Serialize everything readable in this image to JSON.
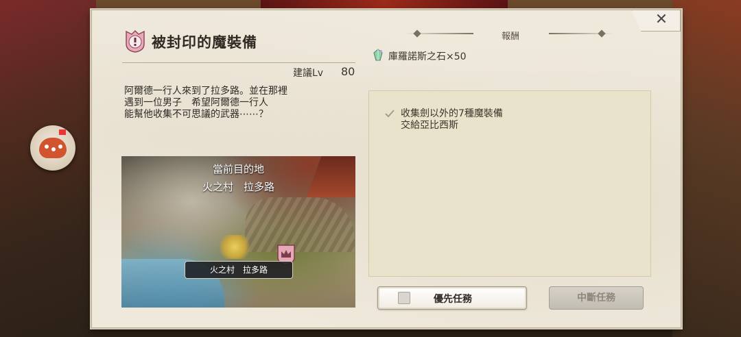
{
  "quest": {
    "title": "被封印的魔裝備",
    "level_label": "建議Lv",
    "level_value": "80",
    "description": "阿爾德一行人來到了拉多路。並在那裡\n遇到一位男子　希望阿爾德一行人\n能幫他收集不可思議的武器⋯⋯？"
  },
  "map": {
    "destination_label": "當前目的地",
    "destination_name": "火之村　拉多路",
    "pin_label": "火之村　拉多路"
  },
  "reward": {
    "header": "報酬",
    "item_text": "庫羅諾斯之石×50"
  },
  "objective": {
    "text": "收集劍以外的7種魔裝備\n交給亞比西斯"
  },
  "buttons": {
    "priority_label": "優先任務",
    "abort_label": "中斷任務",
    "close_label": "✕"
  },
  "colors": {
    "panel_bg": "#efe9dc",
    "objective_bg": "#e9e3cb",
    "quest_icon_pink": "#e8a9b8",
    "disabled_button": "#c8c3b8"
  },
  "icons": {
    "quest": "exclamation-shield-icon",
    "reward_item": "crystal-icon",
    "check": "check-icon",
    "map_marker": "crown-marker-icon",
    "close": "close-icon"
  }
}
